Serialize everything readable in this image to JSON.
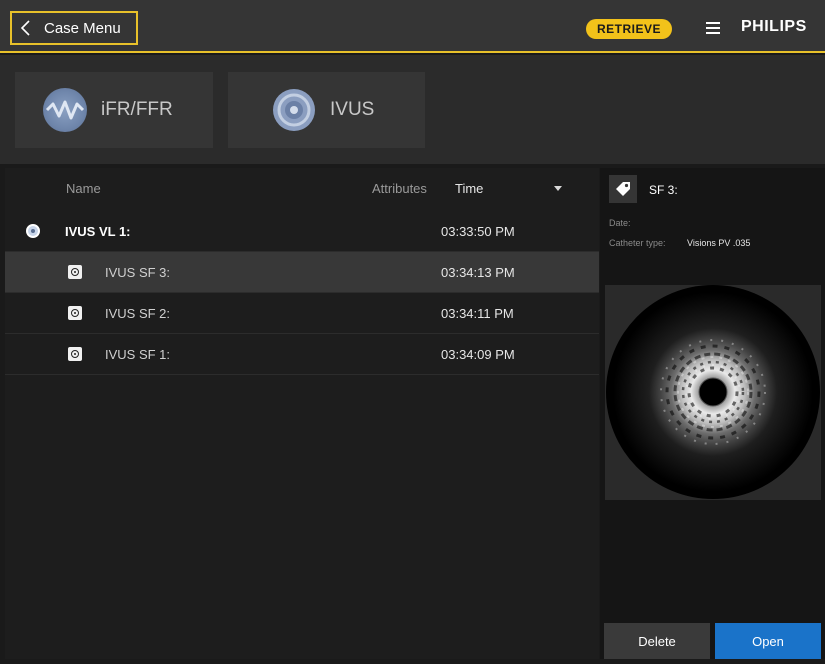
{
  "header": {
    "back_label": "Case Menu",
    "retrieve_label": "RETRIEVE",
    "brand": "PHILIPS"
  },
  "modes": [
    {
      "label": "iFR/FFR",
      "icon": "pressure-wave-icon"
    },
    {
      "label": "IVUS",
      "icon": "ivus-disc-icon"
    }
  ],
  "list": {
    "columns": {
      "name": "Name",
      "attributes": "Attributes",
      "time": "Time"
    },
    "rows": [
      {
        "name": "IVUS VL 1:",
        "time": "03:33:50 PM",
        "icon": "ivus-loop-icon",
        "selected": false,
        "bold": true
      },
      {
        "name": "IVUS  SF 3:",
        "time": "03:34:13 PM",
        "icon": "single-frame-icon",
        "selected": true,
        "bold": false
      },
      {
        "name": "IVUS  SF 2:",
        "time": "03:34:11 PM",
        "icon": "single-frame-icon",
        "selected": false,
        "bold": false
      },
      {
        "name": "IVUS  SF 1:",
        "time": "03:34:09 PM",
        "icon": "single-frame-icon",
        "selected": false,
        "bold": false
      }
    ]
  },
  "detail": {
    "title": "SF 3:",
    "date_label": "Date:",
    "catheter_label": "Catheter type:",
    "catheter_value": "Visions PV .035",
    "delete_label": "Delete",
    "open_label": "Open"
  },
  "colors": {
    "accent": "#e8c12a",
    "retrieve_bg": "#f2c21a",
    "open_button": "#1a73c9",
    "background": "#1a1a1a"
  }
}
